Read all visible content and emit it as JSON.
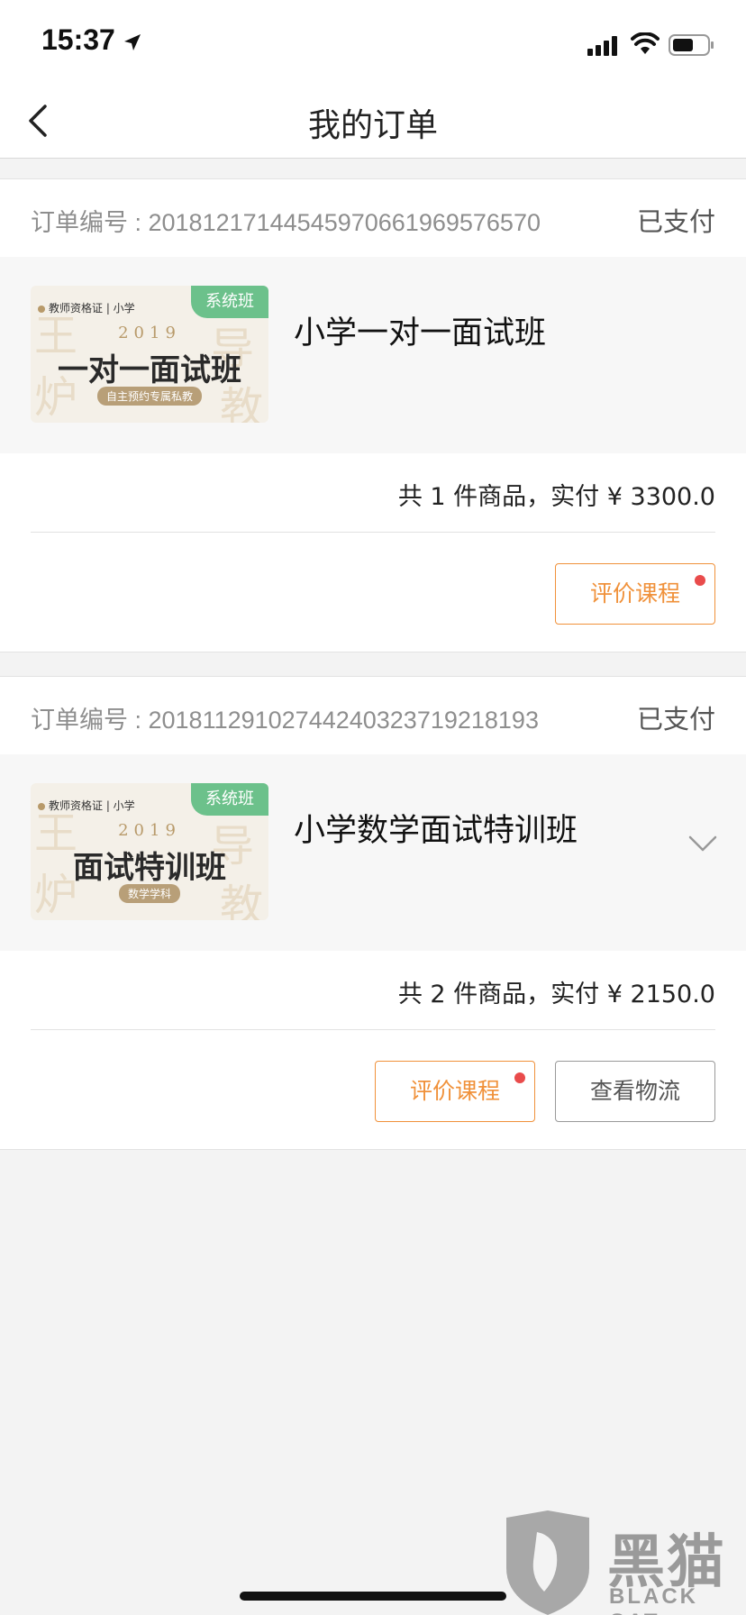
{
  "status_bar": {
    "time": "15:37"
  },
  "nav": {
    "title": "我的订单"
  },
  "orders": [
    {
      "order_no": "订单编号 : 20181217144545970661969576570",
      "status": "已支付",
      "product": {
        "name": "小学一对一面试班",
        "thumb_top": "教师资格证 | 小学",
        "thumb_tag": "系统班",
        "thumb_year": "2019",
        "thumb_main": "一对一面试班",
        "thumb_sub": "自主预约专属私教"
      },
      "summary": "共 1 件商品，实付 ¥ 3300.0",
      "actions": {
        "review": "评价课程"
      }
    },
    {
      "order_no": "订单编号 : 20181129102744240323719218193",
      "status": "已支付",
      "product": {
        "name": "小学数学面试特训班",
        "thumb_top": "教师资格证 | 小学",
        "thumb_tag": "系统班",
        "thumb_year": "2019",
        "thumb_main": "面试特训班",
        "thumb_sub": "数学学科"
      },
      "summary": "共 2 件商品，实付 ¥ 2150.0",
      "actions": {
        "review": "评价课程",
        "logistics": "查看物流"
      }
    }
  ],
  "watermark": {
    "text": "黑猫",
    "sub": "BLACK CAT"
  },
  "colors": {
    "accent": "#f0913a",
    "tag_green": "#6cc18b",
    "badge_red": "#e94b4b"
  },
  "icons": [
    "location-arrow-icon",
    "signal-icon",
    "wifi-icon",
    "battery-icon",
    "back-icon",
    "chevron-down-icon"
  ]
}
